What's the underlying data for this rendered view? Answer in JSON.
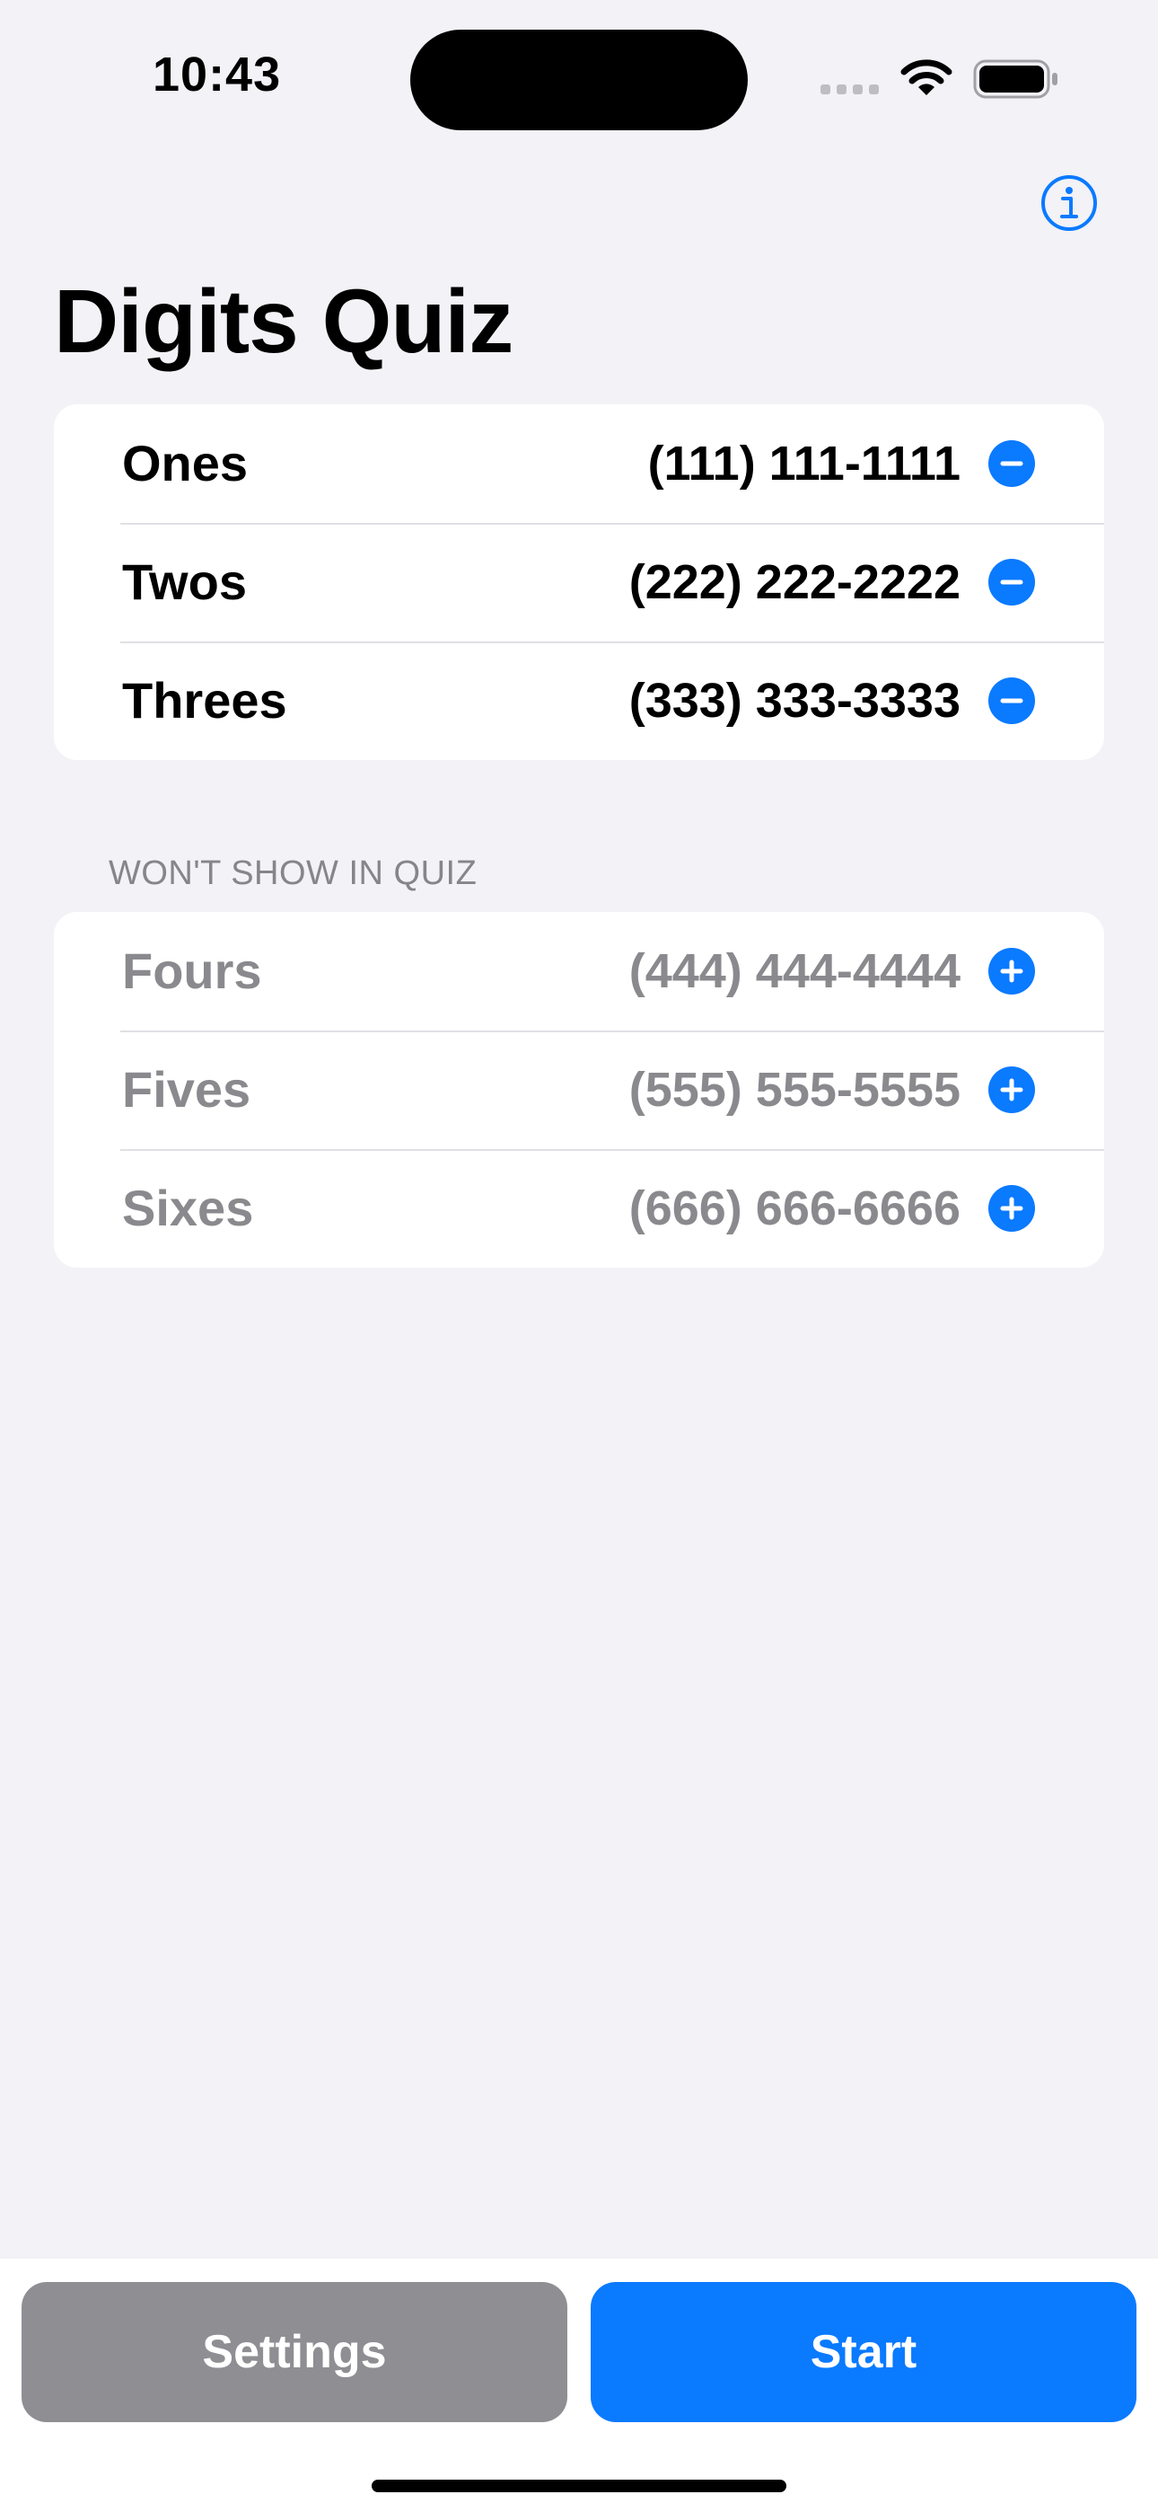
{
  "status_bar": {
    "time": "10:43"
  },
  "header": {
    "info_icon": "info-circle-icon",
    "title": "Digits Quiz"
  },
  "active_list": {
    "items": [
      {
        "name": "Ones",
        "number": "(111) 111-1111",
        "action_icon": "minus-circle-icon"
      },
      {
        "name": "Twos",
        "number": "(222) 222-2222",
        "action_icon": "minus-circle-icon"
      },
      {
        "name": "Threes",
        "number": "(333) 333-3333",
        "action_icon": "minus-circle-icon"
      }
    ]
  },
  "inactive_list": {
    "header": "WON'T SHOW IN QUIZ",
    "items": [
      {
        "name": "Fours",
        "number": "(444) 444-4444",
        "action_icon": "plus-circle-icon"
      },
      {
        "name": "Fives",
        "number": "(555) 555-5555",
        "action_icon": "plus-circle-icon"
      },
      {
        "name": "Sixes",
        "number": "(666) 666-6666",
        "action_icon": "plus-circle-icon"
      }
    ]
  },
  "bottom_bar": {
    "settings_label": "Settings",
    "start_label": "Start"
  },
  "colors": {
    "accent": "#0A7AFF",
    "background": "#F2F2F7",
    "secondary_button": "#8E8E93",
    "muted_text": "#8A8A8E"
  }
}
